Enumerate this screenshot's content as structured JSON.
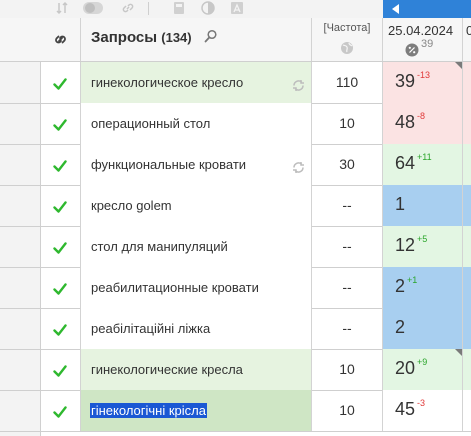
{
  "toolbar": {
    "icons": [
      "sort-icon",
      "toggle-icon",
      "link-icon",
      "calculator-icon",
      "contrast-icon",
      "text-icon"
    ]
  },
  "header": {
    "title": "Запросы",
    "count": "(134)",
    "freq_label": "[Частота]",
    "date_label": "25.04.2024",
    "date_sub": "39",
    "next_date_label": "0"
  },
  "colors": {
    "check": "#2eb82e",
    "pos_red": "#fbe3e3",
    "pos_green": "#e3f6e3",
    "pos_blue": "#a8cff0",
    "query_green": "#e6f3e0",
    "query_green_dark": "#cfe6c5",
    "nav_blue": "#2f82d8"
  },
  "rows": [
    {
      "query": "гинекологическое кресло",
      "freq": "110",
      "pos": "39",
      "delta": "-13",
      "trend": "down",
      "pos_color": "#fbe3e3",
      "query_bg": "#e6f3e0",
      "refresh": true,
      "corner": true,
      "selected": false
    },
    {
      "query": "операционный стол",
      "freq": "10",
      "pos": "48",
      "delta": "-8",
      "trend": "down",
      "pos_color": "#fbe3e3",
      "query_bg": "#ffffff",
      "refresh": false,
      "corner": false,
      "selected": false
    },
    {
      "query": "функциональные кровати",
      "freq": "30",
      "pos": "64",
      "delta": "+11",
      "trend": "up",
      "pos_color": "#e3f6e3",
      "query_bg": "#ffffff",
      "refresh": true,
      "corner": false,
      "selected": false
    },
    {
      "query": "кресло golem",
      "freq": "--",
      "pos": "1",
      "delta": "",
      "trend": "none",
      "pos_color": "#a8cff0",
      "query_bg": "#ffffff",
      "refresh": false,
      "corner": false,
      "selected": false
    },
    {
      "query": "стол для манипуляций",
      "freq": "--",
      "pos": "12",
      "delta": "+5",
      "trend": "up",
      "pos_color": "#e3f6e3",
      "query_bg": "#ffffff",
      "refresh": false,
      "corner": false,
      "selected": false
    },
    {
      "query": "реабилитационные кровати",
      "freq": "--",
      "pos": "2",
      "delta": "+1",
      "trend": "up",
      "pos_color": "#a8cff0",
      "query_bg": "#ffffff",
      "refresh": false,
      "corner": false,
      "selected": false
    },
    {
      "query": "реабілітаційні ліжка",
      "freq": "--",
      "pos": "2",
      "delta": "",
      "trend": "none",
      "pos_color": "#a8cff0",
      "query_bg": "#ffffff",
      "refresh": false,
      "corner": false,
      "selected": false
    },
    {
      "query": "гинекологические кресла",
      "freq": "10",
      "pos": "20",
      "delta": "+9",
      "trend": "up",
      "pos_color": "#e3f6e3",
      "query_bg": "#e6f3e0",
      "refresh": false,
      "corner": true,
      "selected": false
    },
    {
      "query": "гінекологічні крісла",
      "freq": "10",
      "pos": "45",
      "delta": "-3",
      "trend": "down",
      "pos_color": "#ffffff",
      "query_bg": "#cfe6c5",
      "refresh": false,
      "corner": false,
      "selected": true
    }
  ]
}
